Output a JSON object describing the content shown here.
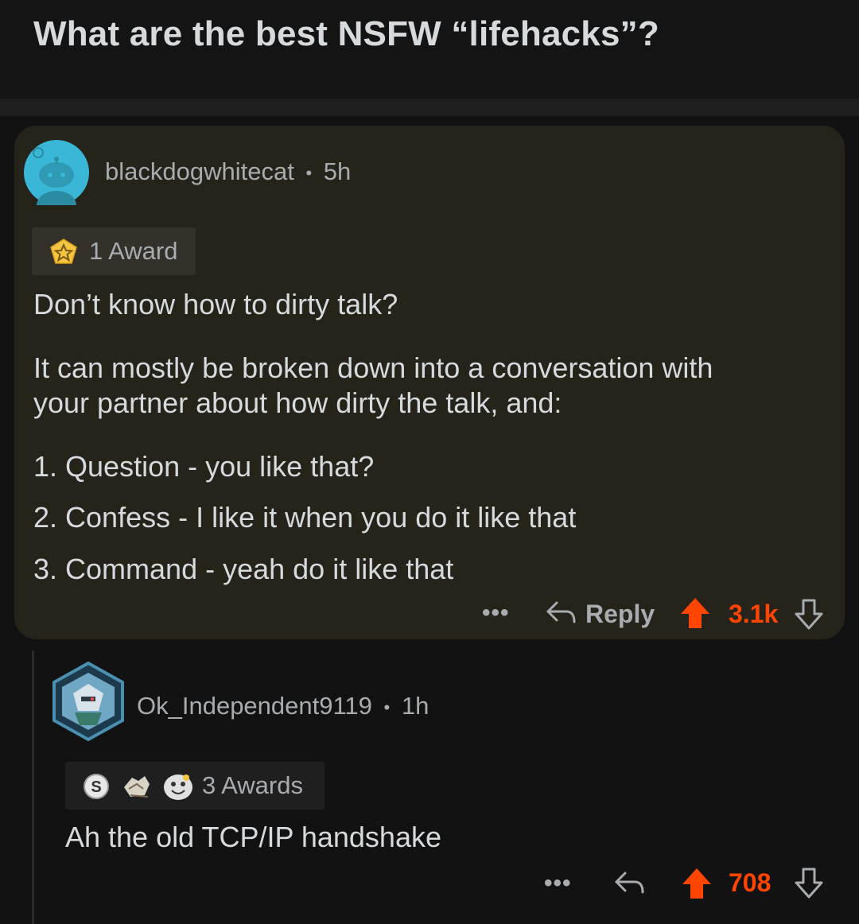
{
  "post": {
    "title": "What are the best NSFW “lifehacks”?"
  },
  "comment": {
    "author": "blackdogwhitecat",
    "separator": "•",
    "age": "5h",
    "award_label": "1 Award",
    "lines": [
      "Don’t know how to dirty talk?",
      "It can mostly be broken down into a conversation with",
      "your partner about how dirty the talk, and:",
      "1. Question - you like that?",
      "2. Confess - I like it when you do it like that",
      "3. Command - yeah do it like that"
    ],
    "more_label": "•••",
    "reply_label": "Reply",
    "votes": "3.1k"
  },
  "reply": {
    "author": "Ok_Independent9119",
    "separator": "•",
    "age": "1h",
    "award_label": "3 Awards",
    "text": "Ah the old TCP/IP handshake",
    "more_label": "•••",
    "votes": "708"
  },
  "icons": {
    "award": "gold-star-award-icon",
    "upvote": "upvote-arrow-icon",
    "downvote": "downvote-arrow-icon",
    "reply": "reply-arrow-icon"
  },
  "colors": {
    "background": "#121212",
    "comment_highlight": "#25231a",
    "upvote": "#ff4500",
    "text": "#d7dadc",
    "muted": "#a8acaf"
  }
}
